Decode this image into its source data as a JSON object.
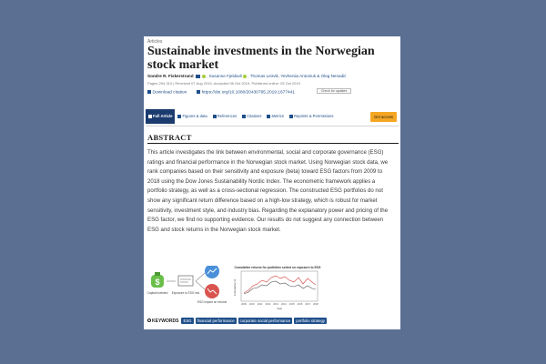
{
  "article": {
    "section": "Articles",
    "title": "Sustainable investments in the Norwegian stock market",
    "authors": [
      "Sondre R. Fiskerstrand",
      "Susanne Fjeldavli",
      "Thomas Leirvik",
      "Yevheniia Antoniuk & Oleg Nenadić"
    ],
    "meta": "Pages 294-310 | Received 07 Aug 2019, Accepted 06 Oct 2019, Published online: 25 Oct 2019",
    "check_updates": "Check for updates",
    "download_citation": "Download citation",
    "doi": "https://doi.org/10.1080/20430795.2019.1677441"
  },
  "tabs": [
    {
      "label": "Full Article",
      "icon": "document-icon",
      "active": true
    },
    {
      "label": "Figures & data",
      "icon": "image-icon",
      "active": false
    },
    {
      "label": "References",
      "icon": "references-icon",
      "active": false
    },
    {
      "label": "Citations",
      "icon": "citations-icon",
      "active": false
    },
    {
      "label": "Metrics",
      "icon": "metrics-icon",
      "active": false
    },
    {
      "label": "Reprints & Permissions",
      "icon": "reprints-icon",
      "active": false
    }
  ],
  "access_button": "Get access",
  "abstract": {
    "heading": "ABSTRACT",
    "text": "This article investigates the link between environmental, social and corporate governance (ESG) ratings and financial performance in the Norwegian stock market. Using Norwegian stock data, we rank companies based on their sensitivity and exposure (beta) toward ESG factors from 2009 to 2018 using the Dow Jones Sustainability Nordic Index. The econometric framework applies a portfolio strategy, as well as a cross-sectional regression. The constructed ESG portfolios do not show any significant return difference based on a high-low strategy, which is robust for market sensitivity, investment style, and industry bias. Regarding the explanatory power and pricing of the ESG factor, we find no supporting evidence. Our results do not suggest any connection between ESG and stock returns in the Norwegian stock market."
  },
  "graphical_abstract": {
    "labels": {
      "capital": "Capital invested",
      "exposure": "Exposure to ESG risk",
      "impact": "ESG impact on returns"
    },
    "chart_title": "Cumulative returns for portfolios sorted on exposure to ESG",
    "xlabel": "Year",
    "ylabel": "Cumulative %",
    "x_ticks": [
      "2009",
      "2010",
      "2011",
      "2012",
      "2013",
      "2014",
      "2015",
      "2016",
      "2017",
      "2018"
    ],
    "colors": {
      "high": "#d9534f",
      "low": "#555555",
      "accent": "#4a90d9"
    }
  },
  "keywords": {
    "label": "KEYWORDS",
    "items": [
      "ESG",
      "financial performance",
      "corporate social performance",
      "portfolio strategy"
    ]
  }
}
